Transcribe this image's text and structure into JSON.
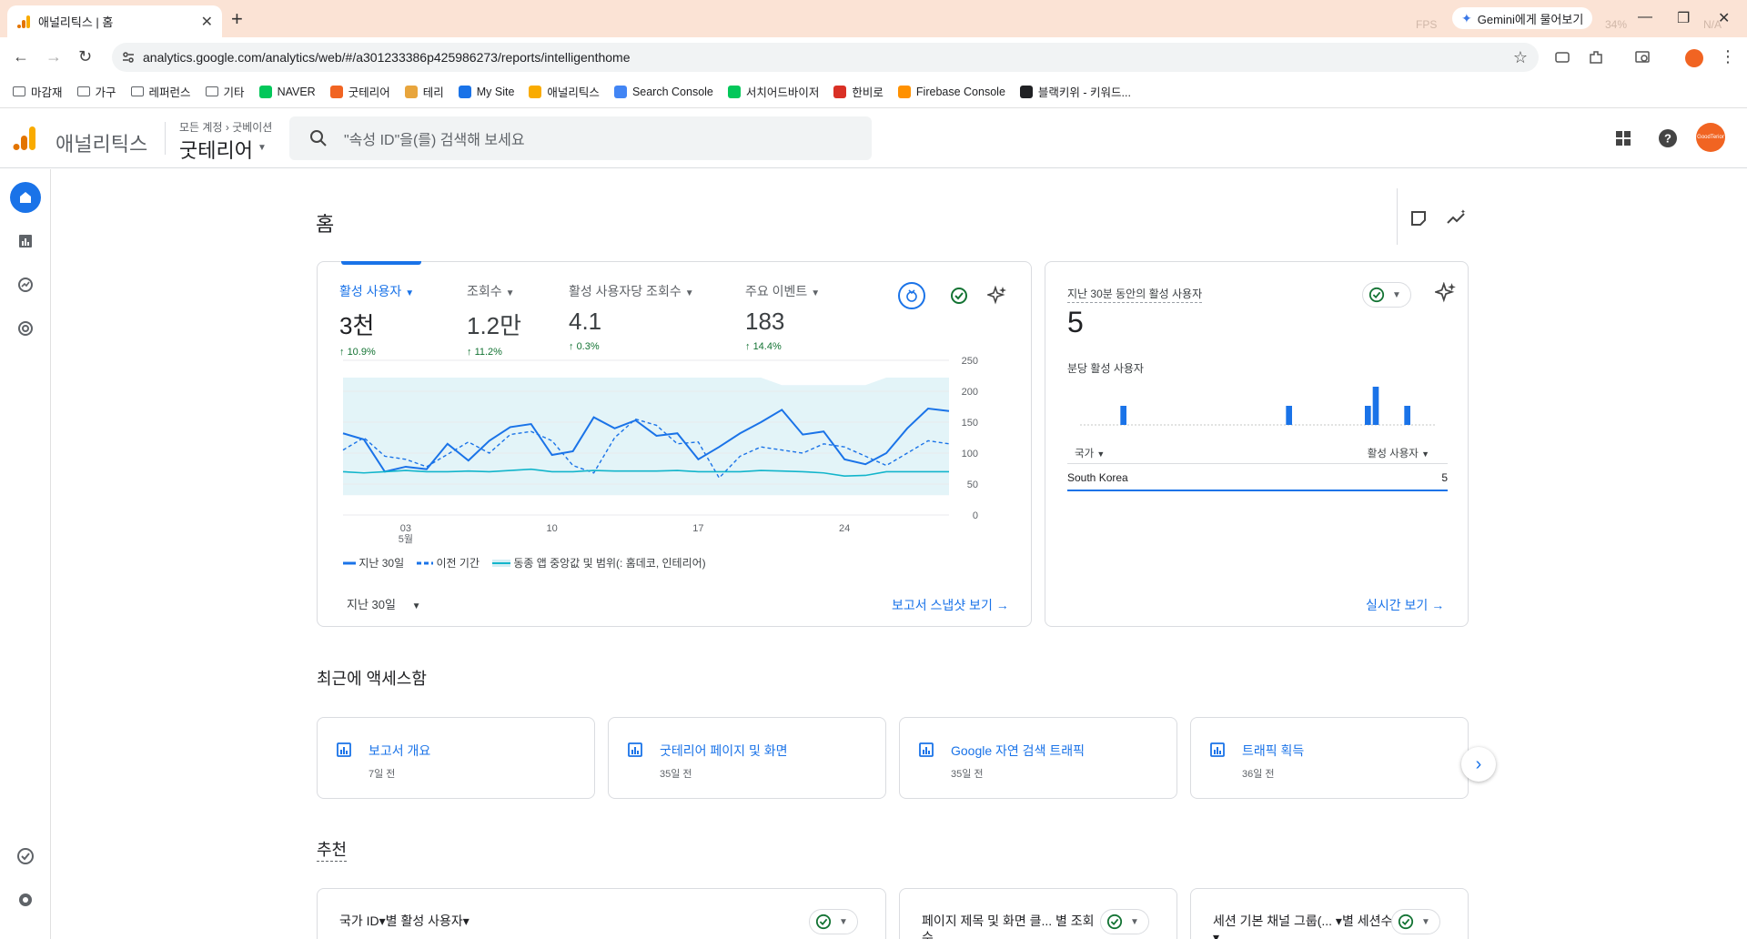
{
  "browser": {
    "tab_title": "애널리틱스 | 홈",
    "tab_close": "✕",
    "new_tab": "+",
    "url": "analytics.google.com/analytics/web/#/a301233386p425986273/reports/intelligenthome",
    "gemini_label": "Gemini에게 물어보기",
    "overlay_text": {
      "fps": "FPS",
      "pct": "34%",
      "na": "N/A"
    },
    "bookmarks": [
      {
        "label": "마감재",
        "icon": "folder-icon"
      },
      {
        "label": "가구",
        "icon": "folder-icon"
      },
      {
        "label": "레퍼런스",
        "icon": "folder-icon"
      },
      {
        "label": "기타",
        "icon": "folder-icon"
      },
      {
        "label": "NAVER",
        "icon": "naver-icon"
      },
      {
        "label": "굿테리어",
        "icon": "goodterior-icon"
      },
      {
        "label": "테리",
        "icon": "teri-icon"
      },
      {
        "label": "My Site",
        "icon": "mysite-icon"
      },
      {
        "label": "애널리틱스",
        "icon": "analytics-icon"
      },
      {
        "label": "Search Console",
        "icon": "search-console-icon"
      },
      {
        "label": "서치어드바이저",
        "icon": "search-advisor-icon"
      },
      {
        "label": "한비로",
        "icon": "hanbiro-icon"
      },
      {
        "label": "Firebase Console",
        "icon": "firebase-icon"
      },
      {
        "label": "블랙키위 - 키워드...",
        "icon": "blackkiwi-icon"
      }
    ]
  },
  "header": {
    "product": "애널리틱스",
    "breadcrumb_all": "모든 계정",
    "breadcrumb_account": "굿베이션",
    "property": "굿테리어",
    "search_placeholder": "\"속성 ID\"을(를) 검색해 보세요",
    "avatar_text": "GoodTerior"
  },
  "page": {
    "title": "홈"
  },
  "overview": {
    "metrics": [
      {
        "label": "활성 사용자",
        "value": "3천",
        "change": "10.9%",
        "selected": true
      },
      {
        "label": "조회수",
        "value": "1.2만",
        "change": "11.2%"
      },
      {
        "label": "활성 사용자당 조회수",
        "value": "4.1",
        "change": "0.3%"
      },
      {
        "label": "주요 이벤트",
        "value": "183",
        "change": "14.4%"
      }
    ],
    "legend": [
      "지난 30일",
      "이전 기간",
      "동종 앱 중앙값 및 범위(: 홈데코, 인테리어)"
    ],
    "period": "지난 30일",
    "link": "보고서 스냅샷 보기"
  },
  "chart_data": {
    "type": "line",
    "x_ticks": [
      "03",
      "10",
      "17",
      "24"
    ],
    "x_month": "5월",
    "y_ticks": [
      "0",
      "50",
      "100",
      "150",
      "200",
      "250"
    ],
    "ylim": [
      0,
      250
    ],
    "series": [
      {
        "name": "지난 30일",
        "color": "#1a73e8",
        "style": "solid",
        "values": [
          132,
          122,
          70,
          78,
          74,
          115,
          88,
          120,
          142,
          147,
          97,
          103,
          158,
          140,
          153,
          128,
          132,
          90,
          110,
          132,
          150,
          170,
          130,
          135,
          90,
          82,
          100,
          140,
          172,
          168
        ]
      },
      {
        "name": "이전 기간",
        "color": "#1a73e8",
        "style": "dashed",
        "values": [
          105,
          125,
          95,
          90,
          78,
          98,
          118,
          100,
          130,
          135,
          120,
          80,
          68,
          125,
          155,
          145,
          115,
          118,
          60,
          95,
          110,
          105,
          100,
          115,
          110,
          95,
          80,
          100,
          120,
          115
        ]
      },
      {
        "name": "동종 앱 중앙값",
        "color": "#12b5cb",
        "style": "solid",
        "values": [
          70,
          68,
          70,
          72,
          70,
          70,
          71,
          70,
          72,
          74,
          70,
          70,
          72,
          71,
          71,
          71,
          72,
          70,
          70,
          70,
          72,
          71,
          70,
          68,
          63,
          64,
          70,
          70,
          70,
          70
        ]
      }
    ],
    "range_band": {
      "upper": 222,
      "lower": 32
    }
  },
  "realtime": {
    "label": "지난 30분 동안의 활성 사용자",
    "value": "5",
    "sub_label": "분당 활성 사용자",
    "bars": [
      0,
      0,
      0,
      0,
      0,
      1,
      0,
      0,
      0,
      0,
      0,
      0,
      0,
      0,
      0,
      0,
      0,
      0,
      0,
      0,
      0,
      0,
      0,
      0,
      0,
      0,
      1,
      0,
      0,
      0,
      0,
      0,
      0,
      0,
      0,
      0,
      1,
      2,
      0,
      0,
      0,
      1,
      0,
      0,
      0
    ],
    "col_dim": "국가",
    "col_metric": "활성 사용자",
    "rows": [
      {
        "country": "South Korea",
        "users": "5"
      }
    ],
    "link": "실시간 보기"
  },
  "recent": {
    "title": "최근에 액세스함",
    "items": [
      {
        "title": "보고서 개요",
        "time": "7일 전"
      },
      {
        "title": "굿테리어 페이지 및 화면",
        "time": "35일 전"
      },
      {
        "title": "Google 자연 검색 트래픽",
        "time": "35일 전"
      },
      {
        "title": "트래픽 획득",
        "time": "36일 전"
      }
    ]
  },
  "recommended": {
    "title": "추천",
    "cards": [
      {
        "title": "국가 ID▾별 활성 사용자▾"
      },
      {
        "title": "페이지 제목 및 화면 클... 별 조회수"
      },
      {
        "title": "세션 기본 채널 그룹(... ▾별 세션수▾"
      }
    ]
  }
}
